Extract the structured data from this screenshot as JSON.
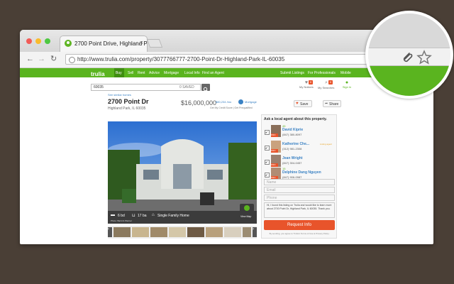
{
  "browser": {
    "tab_title": "2700 Point Drive, Highland Pa",
    "tab_close": "×",
    "url": "http://www.trulia.com/property/3077766777-2700-Point-Dr-Highland-Park-IL-60035",
    "back": "←",
    "forward": "→",
    "reload": "↻"
  },
  "nav": {
    "logo": "trulia",
    "items": [
      "Buy",
      "Sell",
      "Rent",
      "Advice",
      "Mortgage",
      "Local Info",
      "Find an Agent"
    ],
    "right_items": [
      "Submit Listings",
      "For Professionals",
      "Mobile"
    ]
  },
  "account": {
    "notices_label": "My Notices",
    "notices_count": "0",
    "searches_label": "My Searches",
    "searches_count": "0",
    "signin_label": "Sign in"
  },
  "search": {
    "value": "60035",
    "saved": "0 SAVED"
  },
  "listing": {
    "see_similar": "See similar homes",
    "address": "2700 Point Dr",
    "city": "Highland Park, IL 60035",
    "price": "$16,000,000",
    "mortgage_link": "$80,234 /mo",
    "mortgage_label": "Mortgage",
    "sub_links": "Get My Credit Score  |  Get Prequalified",
    "save_label": "Save",
    "share_label": "Share",
    "beds": "6 bd",
    "baths": "17 ba",
    "type": "Single Family Home",
    "view_map": "View Map",
    "photo_caption": "Photo: Baird & Warner"
  },
  "agents_panel": {
    "heading": "Ask a local agent about this property.",
    "agents": [
      {
        "name": "David Kiprie",
        "phone": "(847) 380-8097",
        "badge": "PRO",
        "count": "45"
      },
      {
        "name": "Katherine Che...",
        "phone": "(312) 981-2308",
        "badge": "PRO",
        "count": "",
        "note": "Listing agent"
      },
      {
        "name": "Jean Wright",
        "phone": "(847) 304-0457",
        "badge": "PRO",
        "count": ""
      },
      {
        "name": "Delphine Dang Nguyen",
        "phone": "(847) 906-0987",
        "badge": "PRO",
        "count": "15"
      }
    ],
    "name_placeholder": "Name",
    "email_placeholder": "Email",
    "phone_placeholder": "Phone",
    "message": "Hi, I found this listing on Trulia and would like to learn more about 2700 Point Dr, Highland Park, IL 60035. Thank you.",
    "submit": "Request Info",
    "terms": "By sending, you agree to Trulia's Terms of Use & Privacy Policy."
  },
  "colors": {
    "trulia_green": "#5ab41f",
    "cta_orange": "#e8542b",
    "frame": "#4a3f36"
  }
}
